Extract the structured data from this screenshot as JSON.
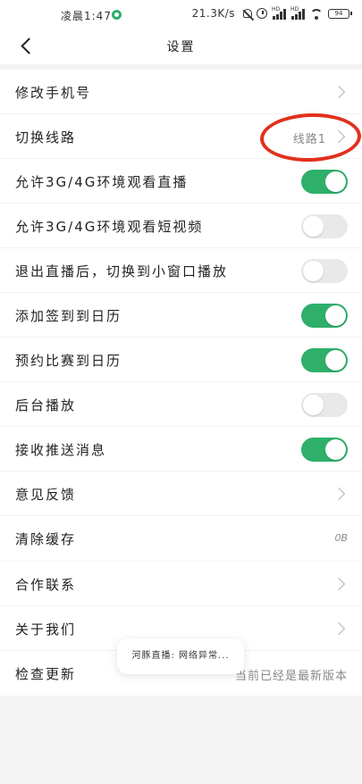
{
  "status_bar": {
    "time": "凌晨1:47",
    "net_speed": "21.3K/s",
    "hd1": "HD",
    "hd2": "HD",
    "battery": "94"
  },
  "header": {
    "title": "设置"
  },
  "settings_group_1": [
    {
      "label": "修改手机号",
      "type": "chevron"
    },
    {
      "label": "切换线路",
      "type": "value-chevron",
      "value": "线路1"
    },
    {
      "label": "允许3G/4G环境观看直播",
      "type": "toggle",
      "on": true
    },
    {
      "label": "允许3G/4G环境观看短视频",
      "type": "toggle",
      "on": false
    },
    {
      "label": "退出直播后，切换到小窗口播放",
      "type": "toggle",
      "on": false
    },
    {
      "label": "添加签到到日历",
      "type": "toggle",
      "on": true
    },
    {
      "label": "预约比赛到日历",
      "type": "toggle",
      "on": true
    },
    {
      "label": "后台播放",
      "type": "toggle",
      "on": false
    },
    {
      "label": "接收推送消息",
      "type": "toggle",
      "on": true
    },
    {
      "label": "意见反馈",
      "type": "chevron"
    },
    {
      "label": "清除缓存",
      "type": "value",
      "value": "0B"
    }
  ],
  "settings_group_2": [
    {
      "label": "合作联系",
      "type": "chevron"
    },
    {
      "label": "关于我们",
      "type": "chevron"
    },
    {
      "label": "检查更新",
      "type": "value",
      "value": "当前已经是最新版本"
    }
  ],
  "toast": {
    "text": "河豚直播: 网络异常..."
  },
  "colors": {
    "accent_green": "#2eaf6a",
    "annotation_red": "#e2301c"
  }
}
